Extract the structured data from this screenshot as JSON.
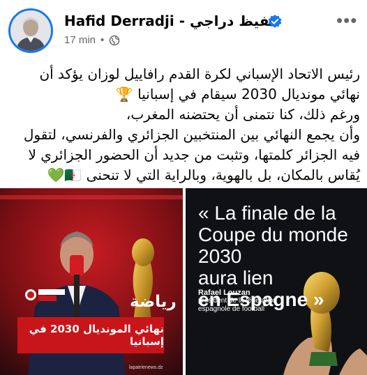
{
  "post": {
    "author_name": "Hafid Derradji - حفيظ دراجي",
    "time": "17 min",
    "separator": "•",
    "more_label": "•••",
    "body_lines": [
      "رئيس الاتحاد الإسباني لكرة القدم رافاييل لوزان يؤكد أن",
      "نهائي مونديال 2030 سيقام في إسبانيا 🏆",
      "ورغم ذلك، كنا نتمنى أن يحتضنه المغرب،",
      "وأن يجمع النهائي بين المنتخبين الجزائري والفرنسي، لتقول",
      "فيه الجزائر كلمتها، وتثبت من جديد أن الحضور الجزائري لا",
      "يُقاس بالمكان، بل بالهوية، وبالراية التي لا تنحنى 🇩🇿💚"
    ]
  },
  "image_left": {
    "logo_text": "La Patrie NEWS",
    "sport_label": "رياضة",
    "banner_text": "نهائي المونديال 2030 في إسبانيا",
    "url_text": "lapatrienews.dz"
  },
  "image_right": {
    "quote_line1": "« La finale de la",
    "quote_line2": "Coupe du monde 2030",
    "quote_line3": "aura lien",
    "quote_line4": "en Espagne »",
    "person_name": "Rafael Louzan",
    "person_role": "président de la fédération espagnole de football"
  },
  "colors": {
    "verified": "#1877f2",
    "meta": "#65676b",
    "banner": "#c8151a"
  }
}
